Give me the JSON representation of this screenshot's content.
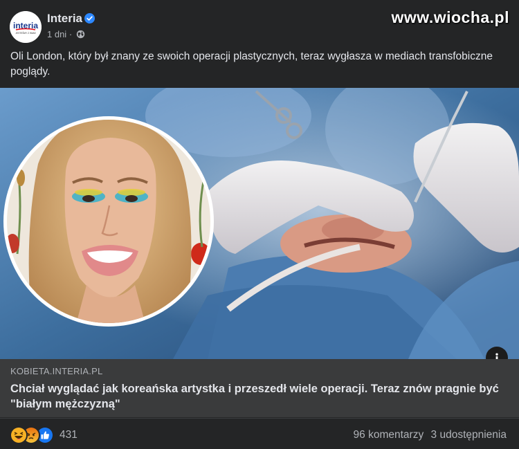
{
  "post": {
    "page_name": "Interia",
    "timestamp": "1 dni",
    "separator": "·",
    "audience_icon": "globe-icon",
    "verified_icon": "verified-badge-icon",
    "avatar_logo": "interia",
    "avatar_tagline": "JESTEŚMY Z WAMI",
    "text": "Oli London, który był znany ze swoich operacji plastycznych, teraz wygłasza w mediach transfobiczne poglądy."
  },
  "watermark": "www.wiocha.pl",
  "link_preview": {
    "domain": "KOBIETA.INTERIA.PL",
    "title": "Chciał wyglądać jak koreańska artystka i przeszedł wiele operacji. Teraz znów pragnie być \"białym mężczyzną\"",
    "info_icon": "info-icon"
  },
  "footer": {
    "reaction_icons": [
      "haha-reaction-icon",
      "angry-reaction-icon",
      "like-reaction-icon"
    ],
    "reaction_count": "431",
    "comments": "96 komentarzy",
    "shares": "3 udostępnienia"
  },
  "colors": {
    "background": "#242526",
    "link_box": "#3a3b3c",
    "text_primary": "#e4e6eb",
    "text_secondary": "#b0b3b8",
    "verified_blue": "#2d88ff",
    "like_blue": "#1877f2",
    "angry_orange": "#e9710f",
    "haha_yellow": "#f7b125"
  }
}
